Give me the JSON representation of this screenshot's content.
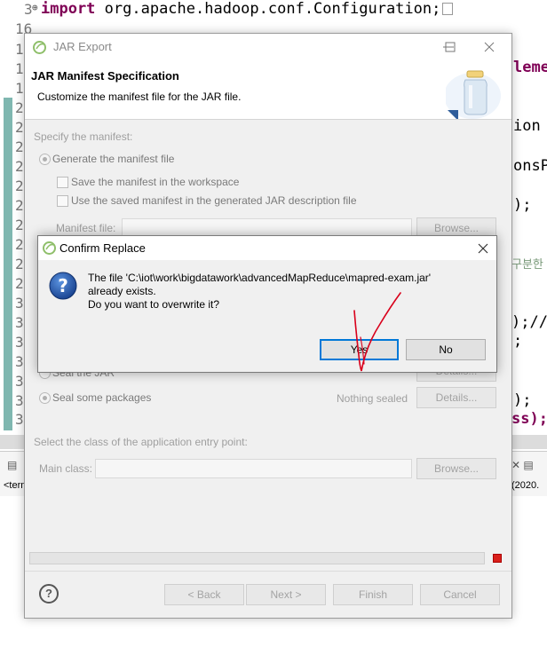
{
  "editor": {
    "line_numbers": [
      "3",
      "16",
      "17",
      "18",
      "19",
      "20",
      "21",
      "22",
      "23",
      "24",
      "25",
      "26",
      "27",
      "28",
      "29",
      "30",
      "31",
      "32",
      "33",
      "34",
      "35",
      "36"
    ],
    "import_keyword": "import",
    "import_text": " org.apache.hadoop.conf.Configuration;",
    "right_fragments": {
      "f1": "leme",
      "f2": "ion",
      "f3": "onsP",
      "f4": ");",
      "f5": "구분한",
      "f6": ");//",
      "f7": ";",
      "f8": ");",
      "f9": "ss);"
    }
  },
  "console": {
    "tab_label": "<term",
    "date_fragment": "(2020."
  },
  "wizard": {
    "title": "JAR Export",
    "heading": "JAR Manifest Specification",
    "description": "Customize the manifest file for the JAR file.",
    "specify_label": "Specify the manifest:",
    "generate_label": "Generate the manifest file",
    "save_label": "Save the manifest in the workspace",
    "reuse_label": "Use the saved manifest in the generated JAR description file",
    "manifest_file_label": "Manifest file:",
    "browse1": "Browse...",
    "seal_jar_label": "Seal the JAR",
    "details1": "Details...",
    "seal_some_label": "Seal some packages",
    "nothing_sealed": "Nothing sealed",
    "details2": "Details...",
    "entry_label": "Select the class of the application entry point:",
    "main_class_label": "Main class:",
    "browse2": "Browse...",
    "back": "< Back",
    "next": "Next >",
    "finish": "Finish",
    "cancel": "Cancel",
    "help_symbol": "?"
  },
  "confirm": {
    "title": "Confirm Replace",
    "message_line1": "The file 'C:\\iot\\work\\bigdatawork\\advancedMapReduce\\mapred-exam.jar'",
    "message_line2": "already exists.",
    "message_line3": "Do you want to overwrite it?",
    "yes": "Yes",
    "no": "No"
  },
  "colors": {
    "keyword": "#7f0055",
    "accent": "#0078d7",
    "annotation": "#d9001b",
    "change_bar": "#7fb7b0"
  }
}
